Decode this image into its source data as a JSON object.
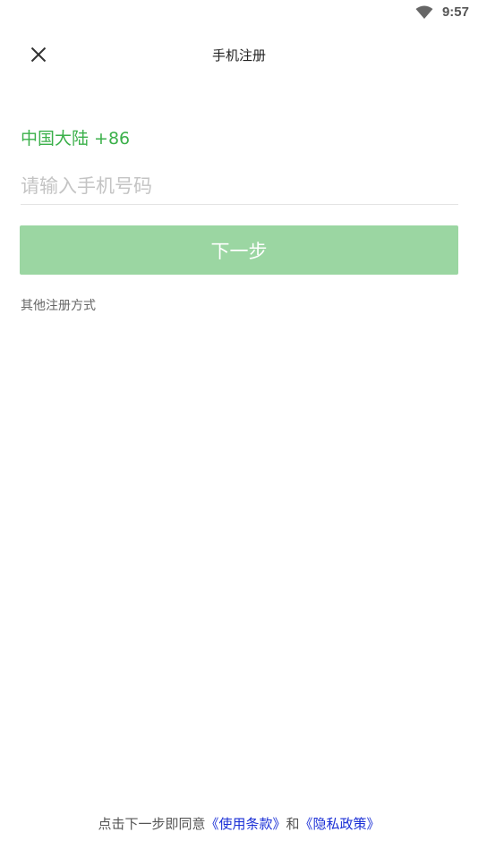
{
  "status_bar": {
    "time": "9:57",
    "wifi_icon": "wifi-icon"
  },
  "header": {
    "close_icon": "close-icon",
    "title": "手机注册"
  },
  "form": {
    "region": "中国大陆 +86",
    "phone_placeholder": "请输入手机号码",
    "phone_value": "",
    "next_label": "下一步"
  },
  "other_methods": "其他注册方式",
  "agreement": {
    "prefix": "点击下一步即同意",
    "terms_link": "《使用条款》",
    "and": "和",
    "privacy_link": "《隐私政策》"
  },
  "colors": {
    "accent_green": "#3bb04a",
    "button_disabled": "#9bd6a2",
    "link_blue": "#1a2fd6"
  }
}
